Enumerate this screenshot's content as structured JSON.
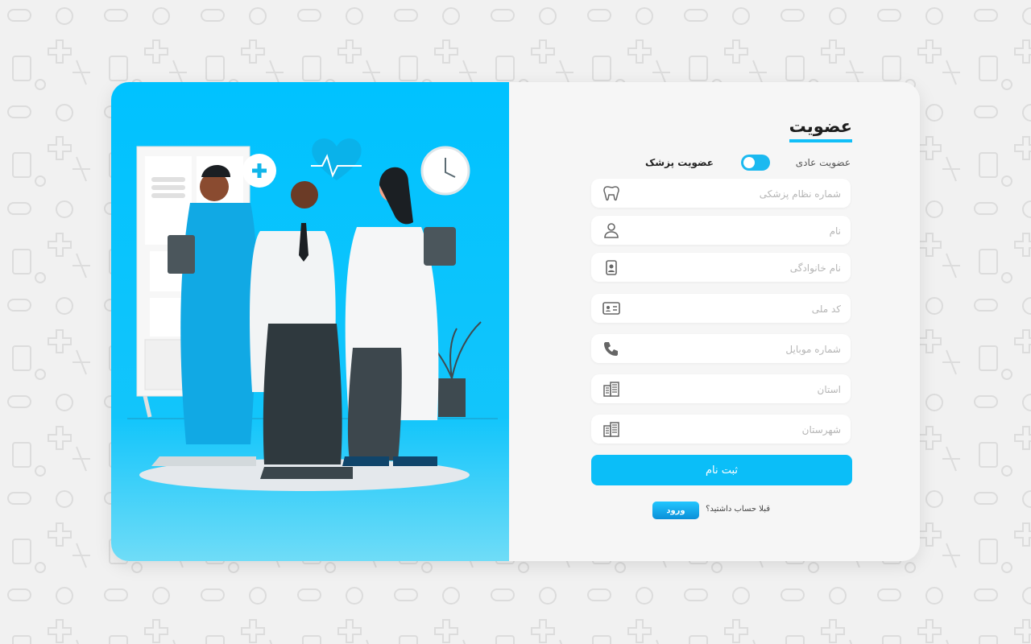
{
  "form": {
    "title": "عضویت",
    "membership_regular": "عضویت عادی",
    "membership_doctor": "عضویت پزشک",
    "fields": [
      {
        "placeholder": "شماره نظام پزشکی",
        "icon": "tooth-icon"
      },
      {
        "placeholder": "نام",
        "icon": "user-icon"
      },
      {
        "placeholder": "نام خانوادگی",
        "icon": "id-badge-icon"
      },
      {
        "placeholder": "کد ملی",
        "icon": "id-card-icon"
      },
      {
        "placeholder": "شماره موبایل",
        "icon": "phone-icon"
      },
      {
        "placeholder": "استان",
        "icon": "building-icon"
      },
      {
        "placeholder": "شهرستان",
        "icon": "building-icon"
      }
    ],
    "submit_label": "ثبت نام",
    "login_question": "قبلا حساب داشتید؟",
    "login_label": "ورود"
  },
  "colors": {
    "accent": "#0bbef8",
    "illustration_bg": "#00c2ff",
    "page_bg": "#f1f1f1"
  }
}
